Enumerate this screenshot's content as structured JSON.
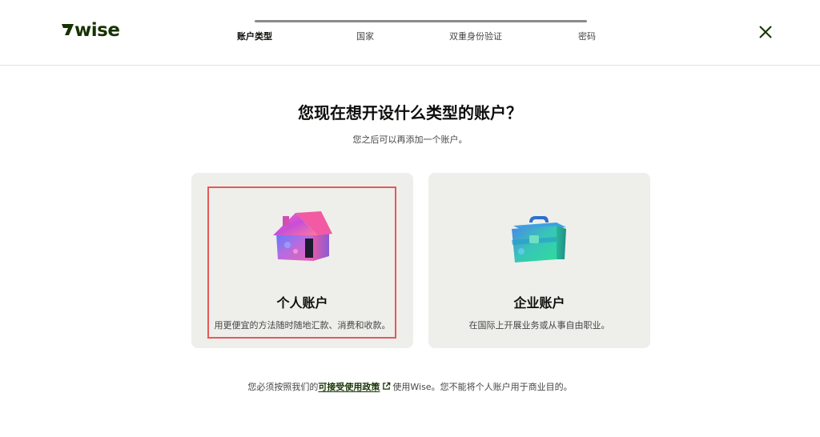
{
  "brand": {
    "name": "Wise",
    "logo_color": "#163300"
  },
  "progress": {
    "steps": [
      {
        "label": "账户类型",
        "active": true
      },
      {
        "label": "国家",
        "active": false
      },
      {
        "label": "双重身份验证",
        "active": false
      },
      {
        "label": "密码",
        "active": false
      }
    ]
  },
  "header": {
    "close_icon": "close-icon"
  },
  "main": {
    "title": "您现在想开设什么类型的账户？",
    "subtitle": "您之后可以再添加一个账户。",
    "cards": [
      {
        "title": "个人账户",
        "description": "用更便宜的方法随时随地汇款、消费和收款。",
        "icon": "house-icon",
        "selected": true
      },
      {
        "title": "企业账户",
        "description": "在国际上开展业务或从事自由职业。",
        "icon": "briefcase-icon",
        "selected": false
      }
    ]
  },
  "footer": {
    "prefix": "您必须按照我们的",
    "link_text": "可接受使用政策",
    "suffix": "使用Wise。您不能将个人账户用于商业目的。",
    "link_icon": "external-link-icon"
  },
  "colors": {
    "accent": "#163300",
    "card_bg": "#eeefea",
    "highlight": "#e55a5a"
  }
}
